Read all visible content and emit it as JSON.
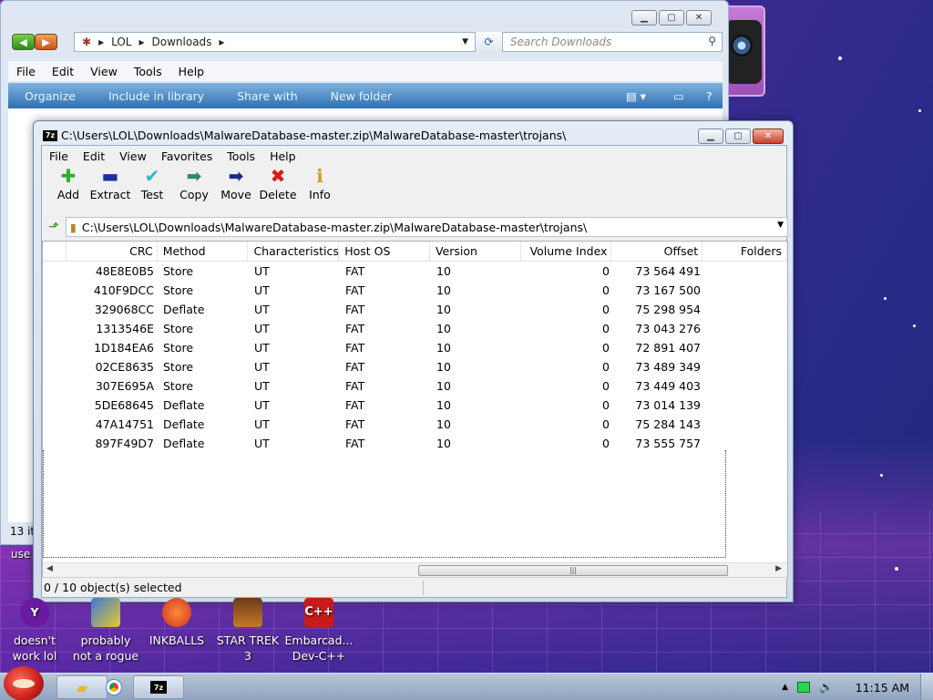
{
  "explorer": {
    "breadcrumb": [
      "LOL",
      "Downloads"
    ],
    "search_placeholder": "Search Downloads",
    "menu": [
      "File",
      "Edit",
      "View",
      "Tools",
      "Help"
    ],
    "commands": [
      "Organize",
      "Include in library",
      "Share with",
      "New folder"
    ],
    "status_text": "13 it",
    "user_label": "use"
  },
  "zip": {
    "title": "C:\\Users\\LOL\\Downloads\\MalwareDatabase-master.zip\\MalwareDatabase-master\\trojans\\",
    "menu": [
      "File",
      "Edit",
      "View",
      "Favorites",
      "Tools",
      "Help"
    ],
    "toolbar": [
      {
        "label": "Add",
        "icon": "add-icon",
        "glyph": "✚",
        "color": "#2fae2a"
      },
      {
        "label": "Extract",
        "icon": "extract-icon",
        "glyph": "▬",
        "color": "#1a2fa0"
      },
      {
        "label": "Test",
        "icon": "test-icon",
        "glyph": "✔",
        "color": "#2ab8c8"
      },
      {
        "label": "Copy",
        "icon": "copy-icon",
        "glyph": "➡",
        "color": "#2a8a6a"
      },
      {
        "label": "Move",
        "icon": "move-icon",
        "glyph": "➡",
        "color": "#1a2a8a"
      },
      {
        "label": "Delete",
        "icon": "delete-icon",
        "glyph": "✖",
        "color": "#d81a1a"
      },
      {
        "label": "Info",
        "icon": "info-icon",
        "glyph": "ℹ",
        "color": "#c8a01a"
      }
    ],
    "path": "C:\\Users\\LOL\\Downloads\\MalwareDatabase-master.zip\\MalwareDatabase-master\\trojans\\",
    "columns": [
      "CRC",
      "Method",
      "Characteristics",
      "Host OS",
      "Version",
      "Volume Index",
      "Offset",
      "Folders"
    ],
    "rows": [
      [
        "48E8E0B5",
        "Store",
        "UT",
        "FAT",
        "10",
        "0",
        "73 564 491"
      ],
      [
        "410F9DCC",
        "Store",
        "UT",
        "FAT",
        "10",
        "0",
        "73 167 500"
      ],
      [
        "329068CC",
        "Deflate",
        "UT",
        "FAT",
        "10",
        "0",
        "75 298 954"
      ],
      [
        "1313546E",
        "Store",
        "UT",
        "FAT",
        "10",
        "0",
        "73 043 276"
      ],
      [
        "1D184EA6",
        "Store",
        "UT",
        "FAT",
        "10",
        "0",
        "72 891 407"
      ],
      [
        "02CE8635",
        "Store",
        "UT",
        "FAT",
        "10",
        "0",
        "73 489 349"
      ],
      [
        "307E695A",
        "Store",
        "UT",
        "FAT",
        "10",
        "0",
        "73 449 403"
      ],
      [
        "5DE68645",
        "Deflate",
        "UT",
        "FAT",
        "10",
        "0",
        "73 014 139"
      ],
      [
        "47A14751",
        "Deflate",
        "UT",
        "FAT",
        "10",
        "0",
        "75 284 143"
      ],
      [
        "897F49D7",
        "Deflate",
        "UT",
        "FAT",
        "10",
        "0",
        "73 555 757"
      ]
    ],
    "status": "0 / 10 object(s) selected"
  },
  "desktop_icons": [
    {
      "label": "doesn't work lol",
      "icon": "yahoo-icon",
      "color": "#6a1aa0"
    },
    {
      "label": "probably not a rogue",
      "icon": "installer-icon",
      "color": "#3a7ad8"
    },
    {
      "label": "INKBALLS",
      "icon": "inkballs-icon",
      "color": "#d84a2a"
    },
    {
      "label": "STAR TREK 3",
      "icon": "star-wars-icon",
      "color": "#c87a2a"
    },
    {
      "label": "Embarcad... Dev-C++",
      "icon": "devcpp-icon",
      "color": "#c81a1a"
    }
  ],
  "taskbar": {
    "clock": "11:15 AM"
  },
  "colors": {
    "accent": "#2f6fb0",
    "close": "#c9412a"
  }
}
